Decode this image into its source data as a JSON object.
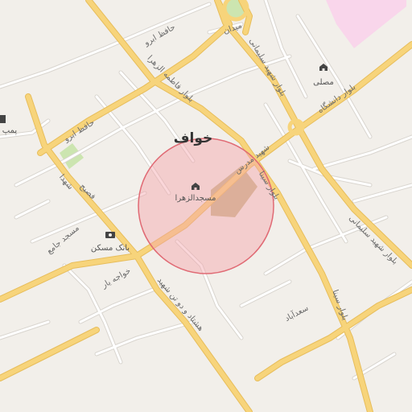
{
  "map": {
    "city_label": "خواف",
    "colors": {
      "background": "#f2efea",
      "major_road": "#f7d47b",
      "major_road_casing": "#e7bd5b",
      "minor_road": "#ffffff",
      "minor_road_casing": "#d8d4cf",
      "park": "#cce5b0",
      "pink_area": "#f9d6eb",
      "mosque_block": "#c9b98c",
      "highlight_fill": "#f3a5ab",
      "highlight_stroke": "#e06a74"
    },
    "road_labels": [
      {
        "id": "hafez-abru-1",
        "text": "حافظ ابرو"
      },
      {
        "id": "hafez-abru-2",
        "text": "حافظ ابرو"
      },
      {
        "id": "fatemeh-zahra",
        "text": "بلوار فاطمه الزهرا"
      },
      {
        "id": "shahid-soleimani-1",
        "text": "بلوار شهید سلیمانی"
      },
      {
        "id": "shahid-soleimani-2",
        "text": "بلوار شهید سلیمانی"
      },
      {
        "id": "daneshgah",
        "text": "بلوار دانشگاه"
      },
      {
        "id": "modarres",
        "text": "شهید مدرس"
      },
      {
        "id": "sina-1",
        "text": "بلوار سینا"
      },
      {
        "id": "sina-2",
        "text": "بلوار سینا"
      },
      {
        "id": "shohada",
        "text": "شهدا"
      },
      {
        "id": "fasih",
        "text": "فصیح"
      },
      {
        "id": "jame",
        "text": "مسجد جامع"
      },
      {
        "id": "khajeh-yar",
        "text": "خواجه یار"
      },
      {
        "id": "hashtad-dovist",
        "text": "هشتاد و دو تن شهید"
      },
      {
        "id": "saadabad",
        "text": "سعدآباد"
      },
      {
        "id": "meydan",
        "text": "میدان"
      }
    ],
    "pois": [
      {
        "id": "mosalla",
        "text": "مصلی",
        "icon": "mosque-icon"
      },
      {
        "id": "masjed-alzahra",
        "text": "مسجدالزهرا",
        "icon": "mosque-icon"
      },
      {
        "id": "bank-maskan",
        "text": "بانک مسکن",
        "icon": "bank-icon"
      },
      {
        "id": "pump",
        "text": "پمپ",
        "icon": "fuel-icon"
      }
    ]
  }
}
